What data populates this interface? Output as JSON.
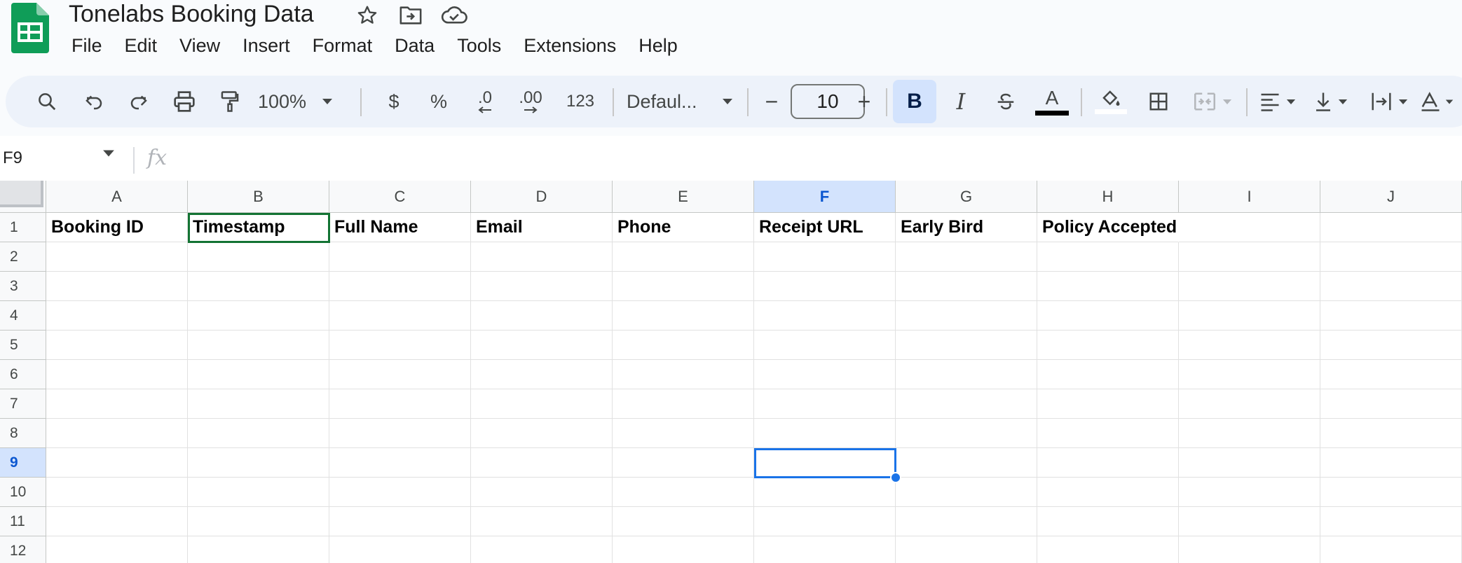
{
  "doc": {
    "title": "Tonelabs Booking Data"
  },
  "colors": {
    "brand_green": "#0f9d58",
    "selection_blue": "#1a73e8",
    "header_selected_bg": "#d3e3fd",
    "toolbar_bg": "#edf2fa"
  },
  "title_icons": [
    "star-icon",
    "move-to-folder-icon",
    "cloud-saved-icon"
  ],
  "menu": [
    "File",
    "Edit",
    "View",
    "Insert",
    "Format",
    "Data",
    "Tools",
    "Extensions",
    "Help"
  ],
  "toolbar": {
    "zoom": "100%",
    "currency": "$",
    "percent": "%",
    "decrease_decimal": ".0",
    "increase_decimal": ".00",
    "number_format": "123",
    "font": "Defaul...",
    "font_size": "10",
    "minus": "−",
    "plus": "+",
    "bold": "B",
    "italic": "I",
    "text_color": "A"
  },
  "formula_bar": {
    "name_box": "F9",
    "fx": "fx",
    "value": ""
  },
  "sheet": {
    "columns": [
      "A",
      "B",
      "C",
      "D",
      "E",
      "F",
      "G",
      "H",
      "I",
      "J"
    ],
    "rows": [
      "1",
      "2",
      "3",
      "4",
      "5",
      "6",
      "7",
      "8",
      "9",
      "10",
      "11",
      "12"
    ],
    "selected_cell": "F9",
    "editing_cell": "B1",
    "header_row": [
      "Booking ID",
      "Timestamp",
      "Full Name",
      "Email",
      "Phone",
      "Receipt URL",
      "Early Bird",
      "Policy Accepted",
      "",
      ""
    ]
  }
}
